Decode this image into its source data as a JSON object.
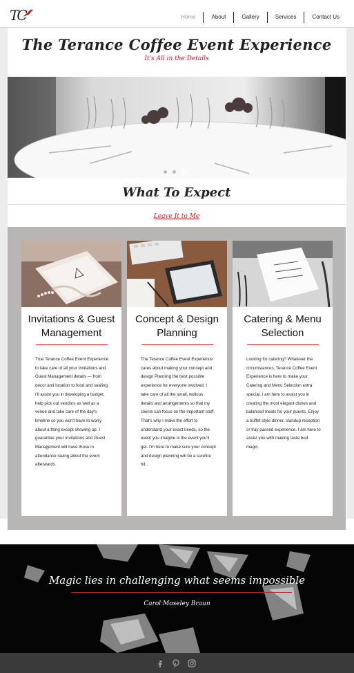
{
  "header": {
    "logo_text": "TC",
    "nav": [
      {
        "label": "Home"
      },
      {
        "label": "About"
      },
      {
        "label": "Gallery"
      },
      {
        "label": "Services"
      },
      {
        "label": "Contact Us"
      }
    ]
  },
  "title_band": {
    "title": "The Terance Coffee Event Experience",
    "tagline": "It's All in the Details"
  },
  "hero": {
    "slide_count": 3,
    "active_slide": 2
  },
  "expect": {
    "title": "What To Expect",
    "tagline": "Leave It to Me"
  },
  "services": [
    {
      "title": "Invitations & Guest Management",
      "body": "True Terance Coffee Event Experience to take care of all your Invitations and Guest Management details — from decor and location to food and seating. I'll assist you in developing a budget, help pick out vendors as well as a venue and take care of the day's timeline so you won't have to worry about a thing except showing up. I guarantee your Invitations and Guest Management will have those in attendance raving about the event afterwards."
    },
    {
      "title": "Concept & Design Planning",
      "body": "The Terance Coffee Event Experience cares about making your concept and design Planning the best possible experience for everyone involved. I take care of all the small, tedious details and arrangements so that my clients can focus on the important stuff. That's why I make the effort to understand your exact needs, so the event you imagine is the event you'll get. I'm here to make sure your concept and design planning will be a surefire hit."
    },
    {
      "title": "Catering & Menu Selection",
      "body": "Looking for catering? Whatever the circumstances, Terance Coffee Event Experience is here to make your Catering and Menu Selection extra special. I am here to assist you in creating the most elegant dishes and balanced meals for your guests. Enjoy a buffet style dinner, standup reception or tray passed experience. I am here to assist you with making taste bud magic."
    }
  ],
  "quote": {
    "text": "Magic lies in challenging what seems impossible",
    "author": "Carol Moseley Braun"
  },
  "footer": {
    "social": [
      "facebook-icon",
      "pinterest-icon",
      "instagram-icon"
    ]
  },
  "colors": {
    "accent": "#c81d25",
    "panel": "#b7b6b5",
    "footer": "#3a3a3a"
  }
}
